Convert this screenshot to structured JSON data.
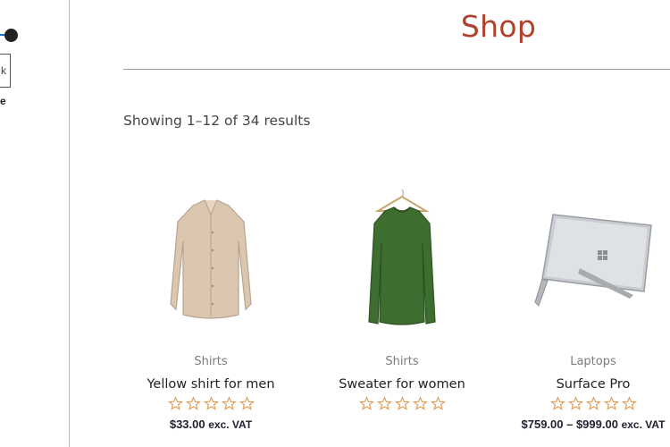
{
  "sidebar": {
    "filter_button_label": "k",
    "price_label": "ice"
  },
  "header": {
    "title": "Shop"
  },
  "shop": {
    "result_count": "Showing 1–12 of 34 results"
  },
  "products": [
    {
      "category": "Shirts",
      "name": "Yellow shirt for men",
      "price": "$33.00",
      "tax_suffix": "exc. VAT",
      "rating_stars": 0,
      "image_icon": "shirt-image"
    },
    {
      "category": "Shirts",
      "name": "Sweater for women",
      "price": "",
      "tax_suffix": "",
      "rating_stars": 0,
      "image_icon": "sweater-image"
    },
    {
      "category": "Laptops",
      "name": "Surface Pro",
      "price": "$759.00 – $999.00",
      "tax_suffix": "exc. VAT",
      "rating_stars": 0,
      "image_icon": "laptop-image"
    }
  ],
  "colors": {
    "title": "#b0412e",
    "star_outline": "#e09a4f",
    "price": "#223"
  }
}
